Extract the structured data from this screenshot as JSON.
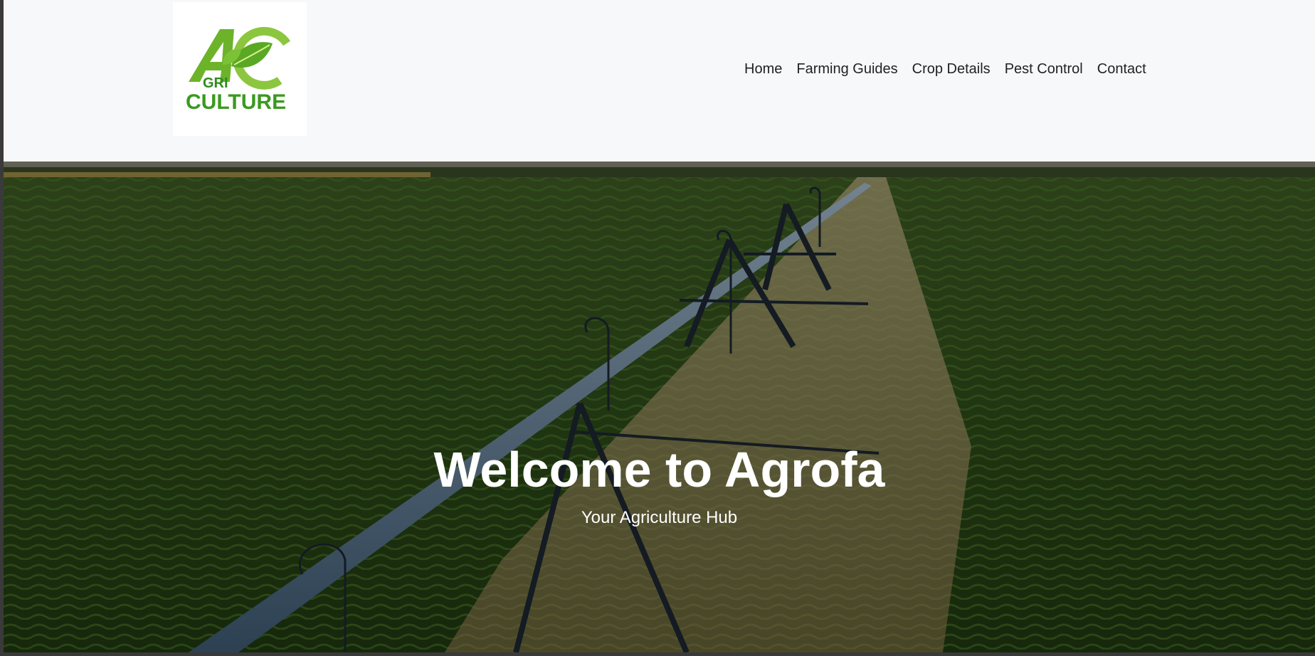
{
  "header": {
    "logo": {
      "text_top": "GRI",
      "text_bottom": "CULTURE",
      "brand_color": "#3a9a1f",
      "accent_color": "#9bd33a"
    },
    "nav": [
      {
        "label": "Home"
      },
      {
        "label": "Farming Guides"
      },
      {
        "label": "Crop Details"
      },
      {
        "label": "Pest Control"
      },
      {
        "label": "Contact"
      }
    ]
  },
  "hero": {
    "title": "Welcome to Agrofa",
    "subtitle": "Your Agriculture Hub",
    "image": "center-pivot-irrigation-field"
  },
  "colors": {
    "header_bg": "#f7f8fa",
    "field_green": "#2f4a1c",
    "text_light": "#ffffff"
  }
}
